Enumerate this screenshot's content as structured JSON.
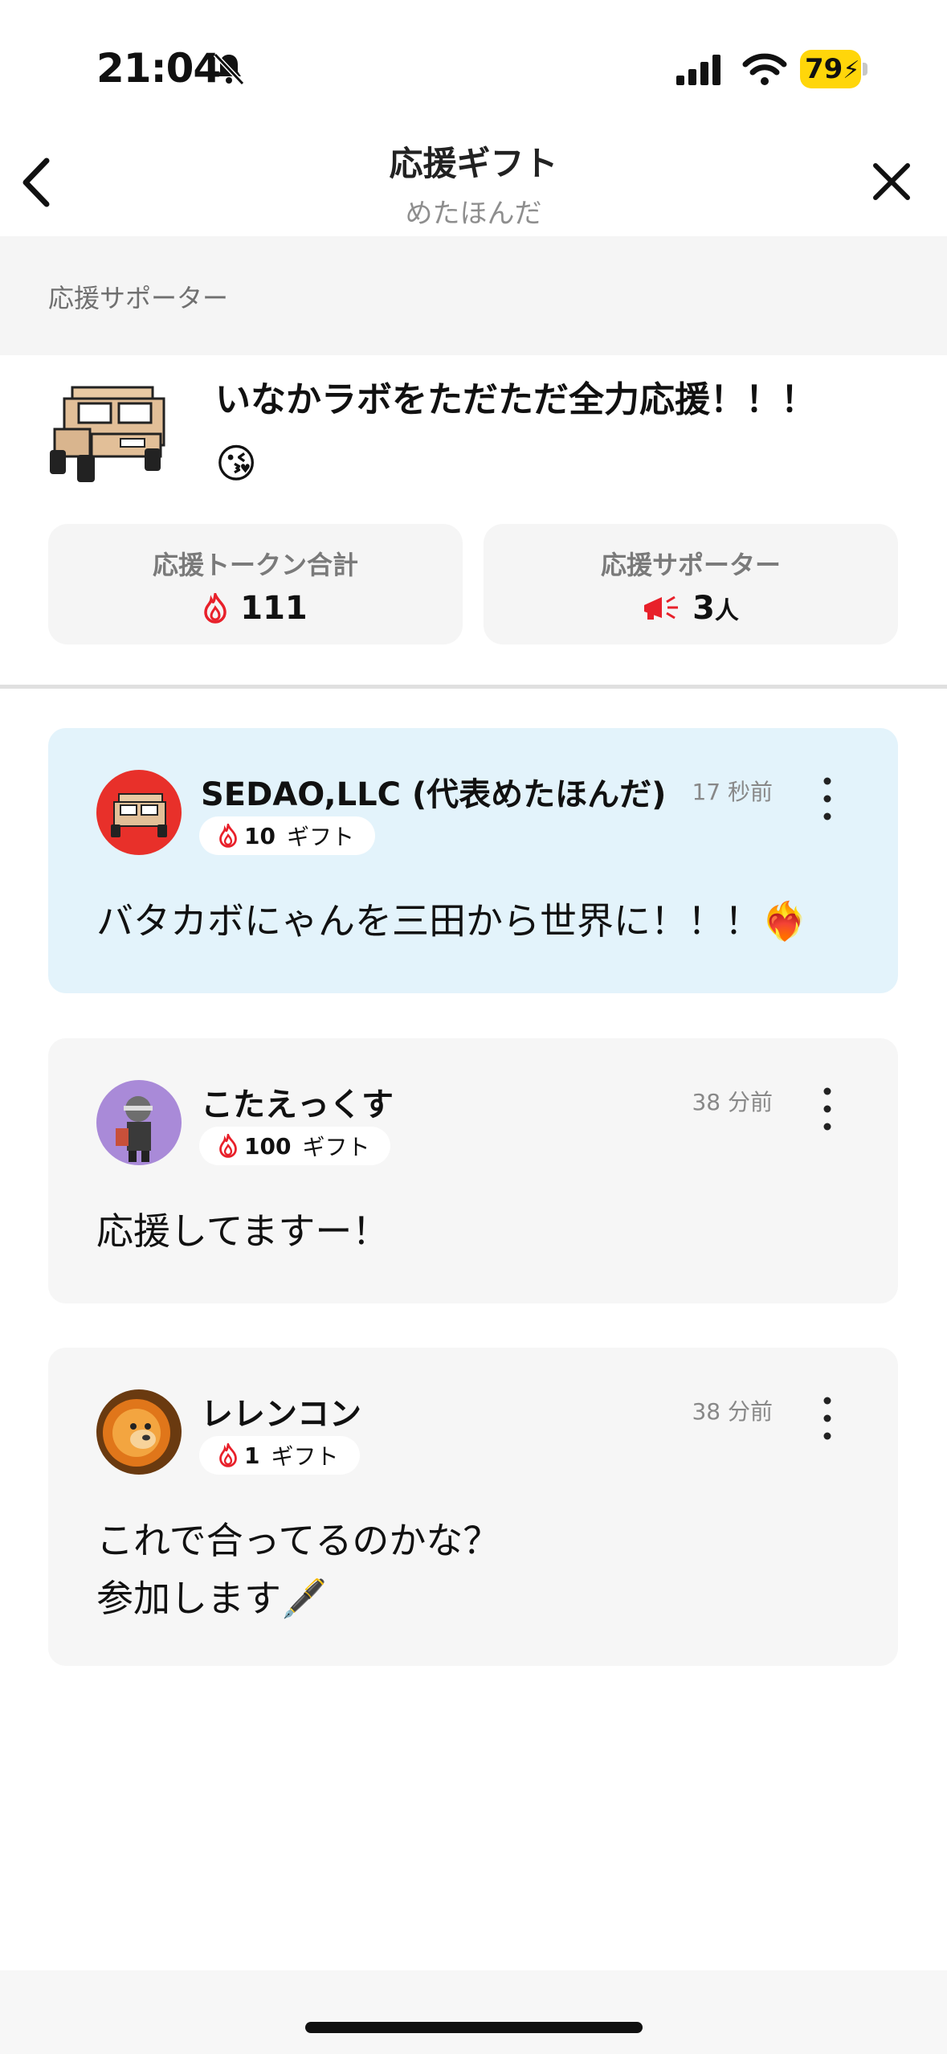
{
  "status_bar": {
    "time": "21:04",
    "battery": "79"
  },
  "nav": {
    "title": "応援ギフト",
    "subtitle": "めたほんだ"
  },
  "section": {
    "label": "応援サポーター"
  },
  "profile": {
    "message": "いなかラボをただただ全力応援！！！",
    "emoji": "😘",
    "stats": [
      {
        "label": "応援トークン合計",
        "value": "111",
        "unit": "",
        "icon": "flame-icon"
      },
      {
        "label": "応援サポーター",
        "value": "3",
        "unit": "人",
        "icon": "megaphone-icon"
      }
    ]
  },
  "comments": [
    {
      "name": "SEDAO,LLC (代表めたほんだ)",
      "time": "17 秒前",
      "gift_count": "10",
      "gift_label": "ギフト",
      "message": "バタカボにゃんを三田から世界に！！！❤️‍🔥",
      "highlighted": true,
      "avatar": "jeep-avatar"
    },
    {
      "name": "こたえっくす",
      "time": "38 分前",
      "gift_count": "100",
      "gift_label": "ギフト",
      "message": "応援してますー！",
      "highlighted": false,
      "avatar": "character-avatar"
    },
    {
      "name": "レレンコン",
      "time": "38 分前",
      "gift_count": "1",
      "gift_label": "ギフト",
      "message": "これで合ってるのかな？\n参加します🖋️",
      "highlighted": false,
      "avatar": "lion-avatar"
    }
  ],
  "colors": {
    "flame": "#e8202a",
    "battery": "#ffd60a",
    "highlight_card": "#e3f3fb",
    "card": "#f6f6f6"
  }
}
